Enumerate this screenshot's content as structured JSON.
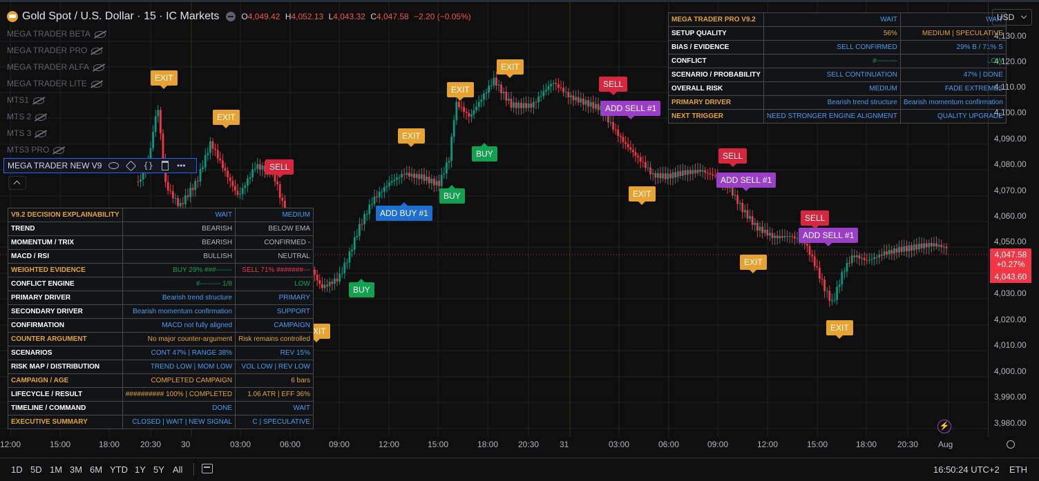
{
  "header": {
    "symbol_title": "Gold Spot / U.S. Dollar · 15 · IC Markets",
    "ohlc": {
      "o_label": "O",
      "o": "4,049.42",
      "h_label": "H",
      "h": "4,052.13",
      "l_label": "L",
      "l": "4,043.32",
      "c_label": "C",
      "c": "4,047.58",
      "change": "−2.20 (−0.05%)"
    },
    "currency": "USD"
  },
  "indicators": [
    "MEGA TRADER BETA",
    "MEGA TRADER PRO",
    "MEGA TRADER ALFA",
    "MEGA TRADER LITE",
    "MTS1",
    "MTS 2",
    "MTS 3",
    "MTS3 PRO"
  ],
  "active_indicator": "MEGA TRADER NEW V9",
  "price_axis": [
    "4,130.00",
    "4,120.00",
    "4,110.00",
    "4,100.00",
    "4,090.00",
    "4,080.00",
    "4,070.00",
    "4,060.00",
    "4,050.00",
    "4,040.00",
    "4,030.00",
    "4,020.00",
    "4,010.00",
    "4,000.00",
    "3,990.00",
    "3,980.00"
  ],
  "price_tags": {
    "last": "4,047.58",
    "pct": "+0.27%",
    "low": "4,043.60"
  },
  "time_axis": [
    "12:00",
    "15:00",
    "18:00",
    "20:30",
    "30",
    "03:00",
    "06:00",
    "09:00",
    "12:00",
    "15:00",
    "18:00",
    "20:30",
    "31",
    "03:00",
    "06:00",
    "09:00",
    "12:00",
    "15:00",
    "18:00",
    "20:30",
    "Aug"
  ],
  "signals": {
    "exit": "EXIT",
    "sell": "SELL",
    "buy": "BUY",
    "add_sell": "ADD SELL #1",
    "add_buy": "ADD BUY #1"
  },
  "top_panel": {
    "rows": [
      [
        "MEGA TRADER PRO V9.2",
        "WAIT",
        "WAIT"
      ],
      [
        "SETUP QUALITY",
        "56%",
        "MEDIUM | SPECULATIVE"
      ],
      [
        "BIAS / EVIDENCE",
        "SELL CONFIRMED",
        "29% B / 71% S"
      ],
      [
        "CONFLICT",
        "#---------",
        "LOW"
      ],
      [
        "SCENARIO / PROBABILITY",
        "SELL CONTINUATION",
        "47% | DONE"
      ],
      [
        "OVERALL RISK",
        "MEDIUM",
        "FADE EXTREMES"
      ],
      [
        "PRIMARY DRIVER",
        "Bearish trend structure",
        "Bearish momentum confirmation"
      ],
      [
        "NEXT TRIGGER",
        "NEED STRONGER ENGINE ALIGNMENT",
        "QUALITY UPGRADE"
      ]
    ],
    "colors": {
      "gold": "#e6a331",
      "blue": "#4a9cf0",
      "green": "#12a150",
      "white": "#ffffff"
    }
  },
  "left_panel": {
    "rows": [
      [
        "V9.2 DECISION EXPLAINABILITY",
        "WAIT",
        "MEDIUM"
      ],
      [
        "TREND",
        "BEARISH",
        "BELOW EMA"
      ],
      [
        "MOMENTUM / TRIX",
        "BEARISH",
        "CONFIRMED -"
      ],
      [
        "MACD / RSI",
        "BULLISH",
        "NEUTRAL"
      ],
      [
        "WEIGHTED EVIDENCE",
        "BUY 29% ###-------",
        "SELL 71% #######---"
      ],
      [
        "CONFLICT ENGINE",
        "#--------- 1/8",
        "LOW"
      ],
      [
        "PRIMARY DRIVER",
        "Bearish trend structure",
        "PRIMARY"
      ],
      [
        "SECONDARY DRIVER",
        "Bearish momentum confirmation",
        "SUPPORT"
      ],
      [
        "CONFIRMATION",
        "MACD not fully aligned",
        "CAMPAIGN"
      ],
      [
        "COUNTER ARGUMENT",
        "No major counter-argument",
        "Risk remains controlled"
      ],
      [
        "SCENARIOS",
        "CONT 47% | RANGE 38%",
        "REV 15%"
      ],
      [
        "RISK MAP / DISTRIBUTION",
        "TREND LOW | MOM LOW",
        "VOL LOW | REV LOW"
      ],
      [
        "CAMPAIGN / AGE",
        "COMPLETED CAMPAIGN",
        "6 bars"
      ],
      [
        "LIFECYCLE / RESULT",
        "########## 100% | COMPLETED",
        "1.06 ATR | EFF 36%"
      ],
      [
        "TIMELINE / COMMAND",
        "DONE",
        "WAIT"
      ],
      [
        "EXECUTIVE SUMMARY",
        "CLOSED | WAIT | NEW SIGNAL",
        "C | SPECULATIVE"
      ]
    ]
  },
  "bottom_bar": {
    "ranges": [
      "1D",
      "5D",
      "1M",
      "3M",
      "6M",
      "YTD",
      "1Y",
      "5Y",
      "All"
    ],
    "clock": "16:50:24 UTC+2",
    "asset": "ETH"
  }
}
